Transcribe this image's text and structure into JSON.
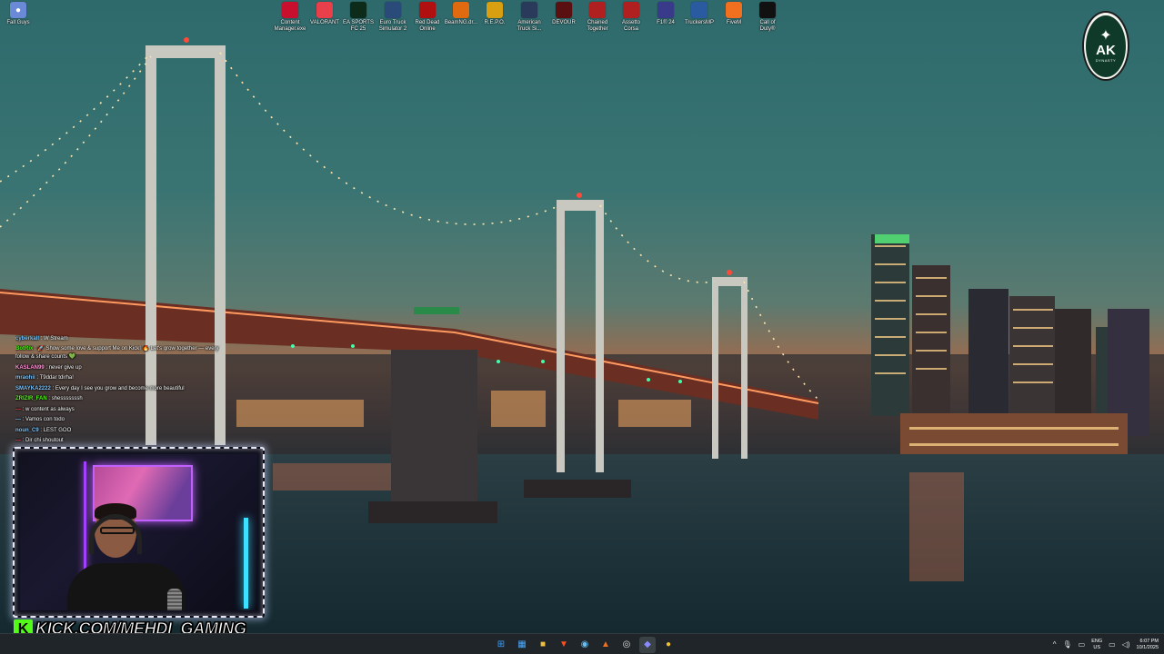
{
  "desktop": {
    "top_icons": [
      {
        "label": "Content\nManager.exe",
        "icon": "content-manager-icon",
        "color": "#c8102e"
      },
      {
        "label": "VALORANT",
        "icon": "valorant-icon",
        "color": "#e8404a"
      },
      {
        "label": "EA SPORTS\nFC 25",
        "icon": "ea-fc-icon",
        "color": "#0d2b1a"
      },
      {
        "label": "Euro Truck\nSimulator 2",
        "icon": "euro-truck-icon",
        "color": "#2a4a7a"
      },
      {
        "label": "Red Dead\nOnline",
        "icon": "red-dead-icon",
        "color": "#b01010"
      },
      {
        "label": "BeamNG.dr...",
        "icon": "beamng-icon",
        "color": "#e06a10"
      },
      {
        "label": "R.E.P.O.",
        "icon": "repo-icon",
        "color": "#d8a010"
      },
      {
        "label": "American\nTruck Si...",
        "icon": "american-truck-icon",
        "color": "#2a3a5a"
      },
      {
        "label": "DEVOUR",
        "icon": "devour-icon",
        "color": "#5a1010"
      },
      {
        "label": "Chained\nTogether",
        "icon": "chained-together-icon",
        "color": "#b02020"
      },
      {
        "label": "Assetto\nCorsa",
        "icon": "assetto-corsa-icon",
        "color": "#b02020"
      },
      {
        "label": "F1® 24",
        "icon": "f1-icon",
        "color": "#3a3a8a"
      },
      {
        "label": "TruckersMP",
        "icon": "truckersmp-icon",
        "color": "#2a5aa0"
      },
      {
        "label": "FiveM",
        "icon": "fivem-icon",
        "color": "#f07020"
      },
      {
        "label": "Call of\nDuty®",
        "icon": "call-of-duty-icon",
        "color": "#111111"
      }
    ],
    "left_icon": {
      "label": "Fall Guys",
      "icon": "fall-guys-icon",
      "color": "#6a8ad8"
    }
  },
  "logo": {
    "monogram": "AK",
    "subtitle": "DYNASTY",
    "icon": "eagle-icon"
  },
  "chat": {
    "messages": [
      {
        "user": "cyberkall",
        "color": "#7ec8ff",
        "text": "W Stream"
      },
      {
        "user": "BotRix",
        "color": "#53fc18",
        "text": "🚀 Show some love & support Me on Kick! 🔥 Let's grow together — every follow & share counts 💚",
        "wrap": true
      },
      {
        "user": "KASLAN99",
        "color": "#ff9ad8",
        "text": "never give up"
      },
      {
        "user": "mraohii",
        "color": "#7ec8ff",
        "text": "T9ddar tdirha!"
      },
      {
        "user": "SMAYKA2222",
        "color": "#7ec8ff",
        "text": "Every day I see you grow and become more beautiful"
      },
      {
        "user": "ZRIZIR_FAN",
        "color": "#53fc18",
        "text": "shesssssssh"
      },
      {
        "user": "—",
        "color": "#ff4040",
        "text": "w content as always"
      },
      {
        "user": "—",
        "color": "#7ec8ff",
        "text": "Vamos con todo"
      },
      {
        "user": "noun_C9",
        "color": "#7ec8ff",
        "text": "LEST GOO"
      },
      {
        "user": "—",
        "color": "#ff4040",
        "text": "Dir chi shoutout"
      }
    ]
  },
  "stream": {
    "platform_icon": "kick-icon",
    "platform_letter": "K",
    "channel_url": "KICK.COM/MEHDI_GAMING",
    "accent": "#53fc18"
  },
  "taskbar": {
    "apps": [
      {
        "name": "start",
        "icon": "windows-start-icon",
        "glyph": "⊞",
        "color": "#3aa0ff"
      },
      {
        "name": "calendar",
        "icon": "calendar-icon",
        "glyph": "▦",
        "color": "#4aa8ff"
      },
      {
        "name": "file-explorer",
        "icon": "folder-icon",
        "glyph": "■",
        "color": "#f0c040"
      },
      {
        "name": "brave",
        "icon": "brave-icon",
        "glyph": "▼",
        "color": "#ff5020"
      },
      {
        "name": "steam",
        "icon": "steam-icon",
        "glyph": "◉",
        "color": "#66c0f4"
      },
      {
        "name": "fivem",
        "icon": "fivem-taskbar-icon",
        "glyph": "▲",
        "color": "#f07020"
      },
      {
        "name": "obs",
        "icon": "obs-icon",
        "glyph": "◎",
        "color": "#e0e0e0"
      },
      {
        "name": "discord",
        "icon": "discord-icon",
        "glyph": "◆",
        "color": "#8a8aff",
        "active": true
      },
      {
        "name": "chrome",
        "icon": "chrome-icon",
        "glyph": "●",
        "color": "#f0c030"
      }
    ],
    "tray": {
      "chevron": "^",
      "lang_top": "ENG",
      "lang_bottom": "US",
      "time": "6:07 PM",
      "date": "10/1/2025"
    }
  }
}
